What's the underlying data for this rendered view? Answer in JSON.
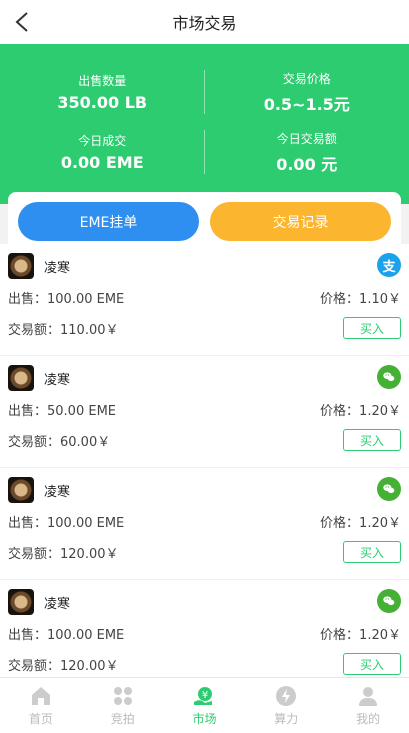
{
  "header": {
    "title": "市场交易"
  },
  "stats": [
    {
      "label": "出售数量",
      "value": "350.00 LB"
    },
    {
      "label": "交易价格",
      "value": "0.5~1.5元"
    },
    {
      "label": "今日成交",
      "value": "0.00 EME"
    },
    {
      "label": "今日交易额",
      "value": "0.00 元"
    }
  ],
  "tabs": {
    "left": "EME挂单",
    "right": "交易记录"
  },
  "colors": {
    "primary": "#2ecc71",
    "blue": "#2f8ff0",
    "orange": "#fbb52e",
    "alipay": "#1aa3ea",
    "wechat": "#45b035"
  },
  "orders": [
    {
      "name": "凌寒",
      "pay_icon": "alipay-icon",
      "pay_glyph": "支",
      "sell": "出售：100.00 EME",
      "price": "价格：1.10￥",
      "amount": "交易额：110.00￥",
      "buy_label": "买入"
    },
    {
      "name": "凌寒",
      "pay_icon": "wechat-icon",
      "pay_glyph": "",
      "sell": "出售：50.00 EME",
      "price": "价格：1.20￥",
      "amount": "交易额：60.00￥",
      "buy_label": "买入"
    },
    {
      "name": "凌寒",
      "pay_icon": "wechat-icon",
      "pay_glyph": "",
      "sell": "出售：100.00 EME",
      "price": "价格：1.20￥",
      "amount": "交易额：120.00￥",
      "buy_label": "买入"
    },
    {
      "name": "凌寒",
      "pay_icon": "wechat-icon",
      "pay_glyph": "",
      "sell": "出售：100.00 EME",
      "price": "价格：1.20￥",
      "amount": "交易额：120.00￥",
      "buy_label": "买入"
    }
  ],
  "tabbar": [
    {
      "label": "首页",
      "icon": "home-icon"
    },
    {
      "label": "竞拍",
      "icon": "grid-icon"
    },
    {
      "label": "市场",
      "icon": "market-icon",
      "active": true
    },
    {
      "label": "算力",
      "icon": "lightning-icon"
    },
    {
      "label": "我的",
      "icon": "user-icon"
    }
  ]
}
